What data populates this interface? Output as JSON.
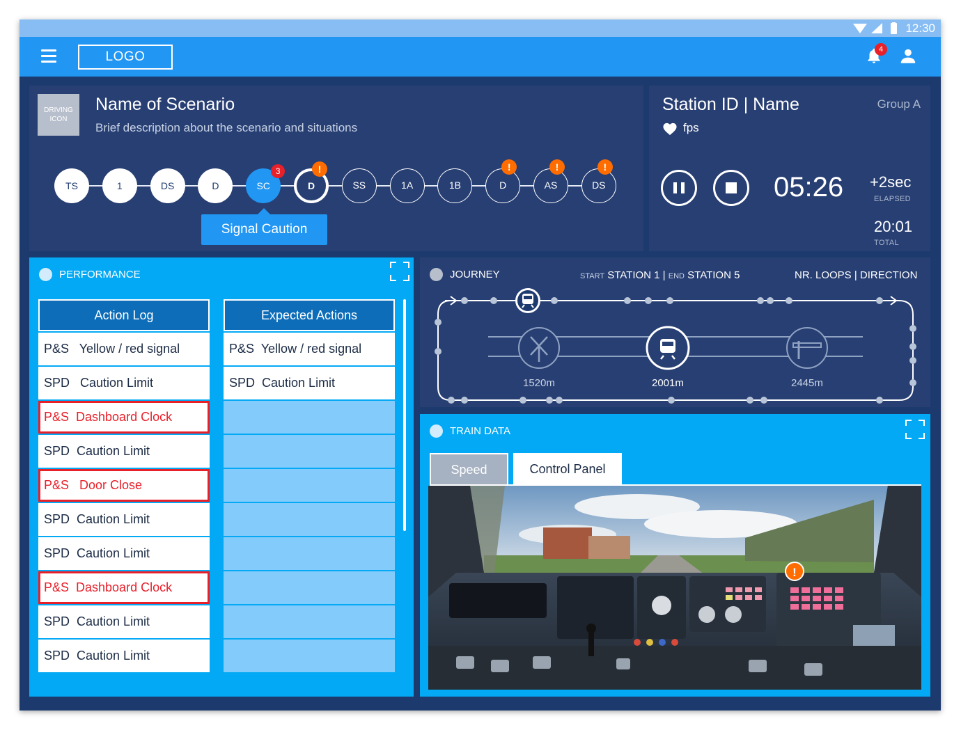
{
  "status_bar": {
    "time": "12:30"
  },
  "app_bar": {
    "logo": "LOGO",
    "notification_count": "4"
  },
  "scenario": {
    "icon_label": "DRIVING ICON",
    "title": "Name of Scenario",
    "description": "Brief description about the scenario and situations",
    "steps": [
      {
        "label": "TS",
        "state": "done"
      },
      {
        "label": "1",
        "state": "done"
      },
      {
        "label": "DS",
        "state": "done"
      },
      {
        "label": "D",
        "state": "done"
      },
      {
        "label": "SC",
        "state": "active",
        "count": "3"
      },
      {
        "label": "D",
        "state": "current",
        "warning": "!"
      },
      {
        "label": "SS",
        "state": "todo"
      },
      {
        "label": "1A",
        "state": "todo"
      },
      {
        "label": "1B",
        "state": "todo"
      },
      {
        "label": "D",
        "state": "todo",
        "warning": "!"
      },
      {
        "label": "AS",
        "state": "todo",
        "warning": "!"
      },
      {
        "label": "DS",
        "state": "todo",
        "warning": "!"
      }
    ],
    "tooltip": "Signal Caution"
  },
  "station": {
    "title": "Station ID | Name",
    "group": "Group A",
    "fps_label": "fps",
    "clock": "05:26",
    "delta": "+2sec",
    "elapsed_label": "ELAPSED",
    "total_time": "20:01",
    "total_label": "TOTAL"
  },
  "performance": {
    "title": "PERFORMANCE",
    "action_log_header": "Action Log",
    "expected_header": "Expected Actions",
    "action_log": [
      {
        "text": "P&S   Yellow / red signal",
        "alert": false
      },
      {
        "text": "SPD   Caution Limit",
        "alert": false
      },
      {
        "text": "P&S  Dashboard Clock",
        "alert": true
      },
      {
        "text": "SPD  Caution Limit",
        "alert": false
      },
      {
        "text": "P&S   Door Close",
        "alert": true
      },
      {
        "text": "SPD  Caution Limit",
        "alert": false
      },
      {
        "text": "SPD  Caution Limit",
        "alert": false
      },
      {
        "text": "P&S  Dashboard Clock",
        "alert": true
      },
      {
        "text": "SPD  Caution Limit",
        "alert": false
      },
      {
        "text": "SPD  Caution Limit",
        "alert": false
      }
    ],
    "expected_actions": [
      "P&S  Yellow / red signal",
      "SPD  Caution Limit",
      "",
      "",
      "",
      "",
      "",
      "",
      "",
      ""
    ]
  },
  "journey": {
    "title": "JOURNEY",
    "start_label": "START",
    "start_station": "STATION 1 |",
    "end_label": "END",
    "end_station": "STATION 5",
    "loops": "NR. LOOPS",
    "direction": "| DIRECTION",
    "distances": [
      "1520m",
      "2001m",
      "2445m"
    ]
  },
  "train_data": {
    "title": "TRAIN DATA",
    "tabs": [
      "Speed",
      "Control Panel"
    ],
    "active_tab": "Control Panel",
    "warning": "!"
  },
  "colors": {
    "app_bar": "#2196f3",
    "background": "#1d3a6e",
    "card": "#283f73",
    "panel": "#03a9f4",
    "alert": "#e8202a",
    "warning": "#ff6d00"
  }
}
